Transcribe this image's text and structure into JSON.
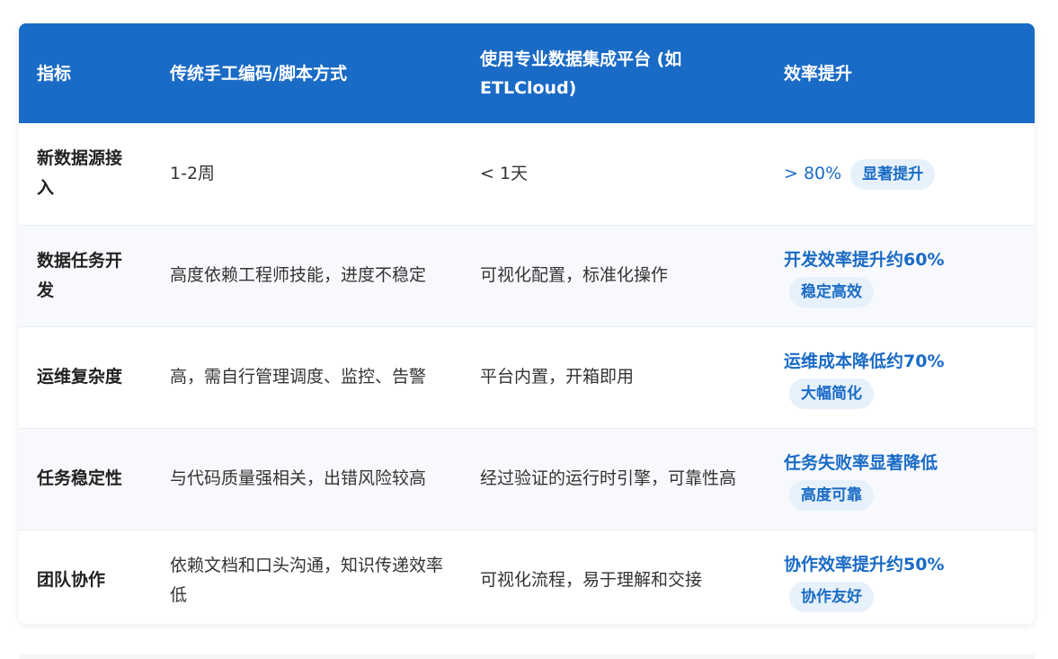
{
  "table": {
    "headers": [
      "指标",
      "传统手工编码/脚本方式",
      "使用专业数据集成平台 (如 ETLCloud)",
      "效率提升"
    ],
    "rows": [
      {
        "metric": "新数据源接入",
        "traditional": "1-2周",
        "platform": "< 1天",
        "gain": "> 80%",
        "badge": "显著提升"
      },
      {
        "metric": "数据任务开发",
        "traditional": "高度依赖工程师技能，进度不稳定",
        "platform": "可视化配置，标准化操作",
        "gain": "开发效率提升约60%",
        "badge": "稳定高效"
      },
      {
        "metric": "运维复杂度",
        "traditional": "高，需自行管理调度、监控、告警",
        "platform": "平台内置，开箱即用",
        "gain": "运维成本降低约70%",
        "badge": "大幅简化"
      },
      {
        "metric": "任务稳定性",
        "traditional": "与代码质量强相关，出错风险较高",
        "platform": "经过验证的运行时引擎，可靠性高",
        "gain": "任务失败率显著降低",
        "badge": "高度可靠"
      },
      {
        "metric": "团队协作",
        "traditional": "依赖文档和口头沟通，知识传递效率低",
        "platform": "可视化流程，易于理解和交接",
        "gain": "协作效率提升约50%",
        "badge": "协作友好"
      }
    ]
  },
  "colors": {
    "header_bg": "#1a6bc6",
    "accent": "#1a6bc6",
    "badge_bg": "#e6f1fb",
    "alt_row_bg": "#f7f9fc"
  }
}
